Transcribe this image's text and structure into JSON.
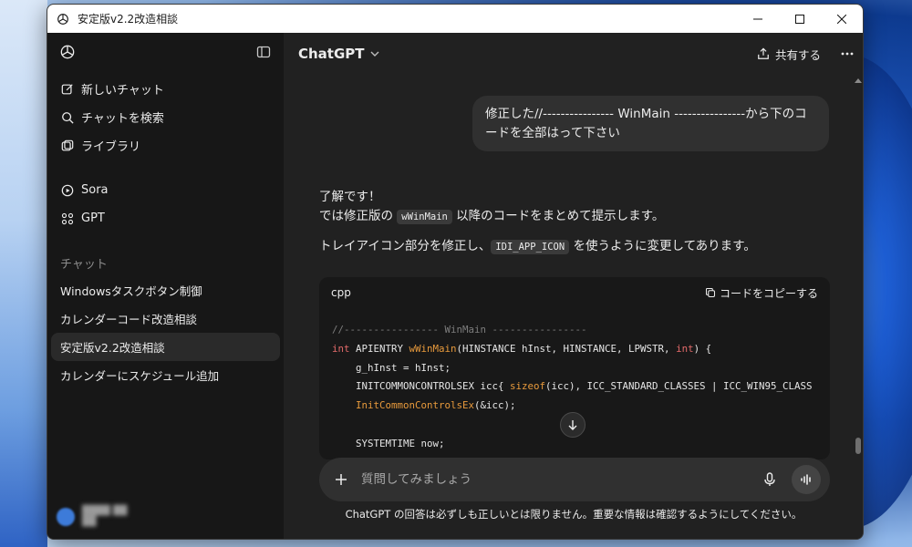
{
  "window": {
    "title": "安定版v2.2改造相談"
  },
  "sidebar": {
    "items": [
      {
        "label": "新しいチャット",
        "icon": "edit-icon"
      },
      {
        "label": "チャットを検索",
        "icon": "search-icon"
      },
      {
        "label": "ライブラリ",
        "icon": "library-icon"
      }
    ],
    "apps": [
      {
        "label": "Sora",
        "icon": "play-icon"
      },
      {
        "label": "GPT",
        "icon": "grid-icon"
      }
    ],
    "section_label": "チャット",
    "chats": [
      {
        "label": "Windowsタスクボタン制御",
        "active": false
      },
      {
        "label": "カレンダーコード改造相談",
        "active": false
      },
      {
        "label": "安定版v2.2改造相談",
        "active": true
      },
      {
        "label": "カレンダーにスケジュール追加",
        "active": false
      }
    ]
  },
  "header": {
    "model": "ChatGPT",
    "share_label": "共有する"
  },
  "conversation": {
    "user_message": "修正した//---------------- WinMain ----------------から下のコードを全部はって下さい",
    "reply_line1": "了解です！",
    "reply_line2_pre": "では修正版の",
    "reply_line2_code": "wWinMain",
    "reply_line2_post": "以降のコードをまとめて提示します。",
    "reply_line3_pre": "トレイアイコン部分を修正し、",
    "reply_line3_code": "IDI_APP_ICON",
    "reply_line3_post": "を使うように変更してあります。"
  },
  "code_block": {
    "language": "cpp",
    "copy_label": "コードをコピーする",
    "lines": {
      "l1": "//---------------- WinMain ----------------",
      "l2_kw": "int",
      "l2_mid": " APIENTRY ",
      "l2_fn": "wWinMain",
      "l2_args": "(HINSTANCE hInst, HINSTANCE, LPWSTR, ",
      "l2_kw2": "int",
      "l2_end": ") {",
      "l3": "    g_hInst = hInst;",
      "l4_pre": "    INITCOMMONCONTROLSEX icc{ ",
      "l4_fn": "sizeof",
      "l4_post": "(icc), ICC_STANDARD_CLASSES | ICC_WIN95_CLASS",
      "l5_fn": "    InitCommonControlsEx",
      "l5_post": "(&icc);",
      "l7": "    SYSTEMTIME now;"
    }
  },
  "composer": {
    "placeholder": "質問してみましょう"
  },
  "disclaimer": "ChatGPT の回答は必ずしも正しいとは限りません。重要な情報は確認するようにしてください。",
  "colors": {
    "sidebar_bg": "#171717",
    "main_bg": "#212121",
    "bubble_bg": "#303030",
    "keyword": "#e36a6a",
    "function": "#e89a3c"
  }
}
